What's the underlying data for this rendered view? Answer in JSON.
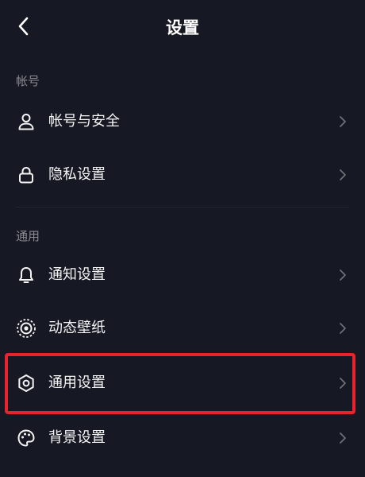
{
  "header": {
    "title": "设置",
    "back_icon": "chevron-left-icon"
  },
  "sections": [
    {
      "label": "帐号",
      "items": [
        {
          "label": "帐号与安全",
          "icon": "user-icon"
        },
        {
          "label": "隐私设置",
          "icon": "lock-icon"
        }
      ]
    },
    {
      "label": "通用",
      "items": [
        {
          "label": "通知设置",
          "icon": "bell-icon"
        },
        {
          "label": "动态壁纸",
          "icon": "live-wallpaper-icon"
        },
        {
          "label": "通用设置",
          "icon": "gear-icon",
          "highlighted": true
        },
        {
          "label": "背景设置",
          "icon": "palette-icon"
        }
      ]
    }
  ],
  "colors": {
    "background": "#161823",
    "text": "#f4f4f5",
    "section_label": "#8a8b91",
    "chevron": "#6f7077",
    "highlight": "#e8232d"
  }
}
